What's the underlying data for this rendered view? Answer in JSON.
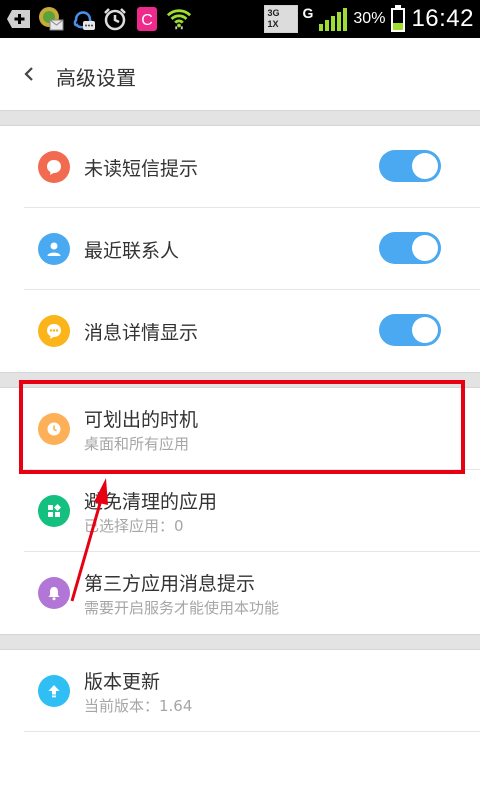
{
  "status_bar": {
    "battery_percent": "30%",
    "time": "16:42",
    "network_top": "3G",
    "network_bottom": "1X",
    "network_g": "G"
  },
  "header": {
    "title": "高级设置"
  },
  "section1": [
    {
      "label": "未读短信提示",
      "icon": "message-bubble-icon",
      "color": "#f26b50",
      "toggle": "on"
    },
    {
      "label": "最近联系人",
      "icon": "contact-person-icon",
      "color": "#49aaf2",
      "toggle": "on"
    },
    {
      "label": "消息详情显示",
      "icon": "chat-dots-icon",
      "color": "#fbb41a",
      "toggle": "on"
    }
  ],
  "section2": [
    {
      "label": "可划出的时机",
      "sub": "桌面和所有应用",
      "icon": "clock-icon",
      "color": "#fdb058"
    },
    {
      "label": "避免清理的应用",
      "sub": "已选择应用：0",
      "icon": "apps-grid-icon",
      "color": "#13c07f"
    },
    {
      "label": "第三方应用消息提示",
      "sub": "需要开启服务才能使用本功能",
      "icon": "bell-icon",
      "color": "#b176d6"
    }
  ],
  "section3": [
    {
      "label": "版本更新",
      "sub": "当前版本：1.64",
      "icon": "upload-arrow-icon",
      "color": "#2fbff4"
    }
  ],
  "colors": {
    "toggle_on": "#4aa9f0",
    "highlight": "#e60012"
  }
}
